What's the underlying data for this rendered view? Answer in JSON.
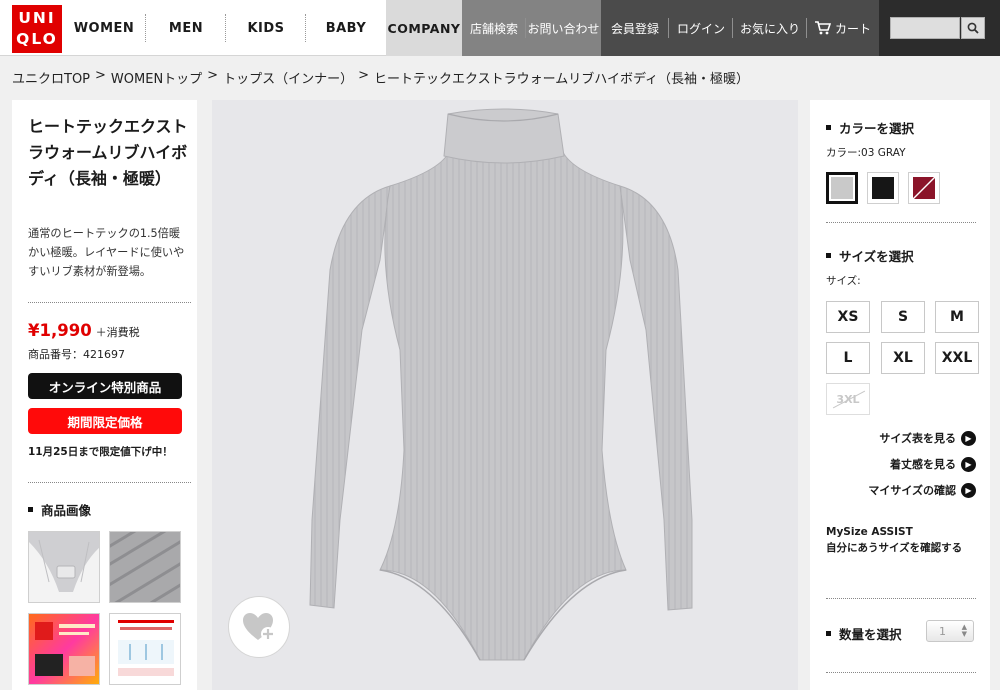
{
  "brand": {
    "logo_line1": "UNI",
    "logo_line2": "QLO",
    "brand_color": "#e00000"
  },
  "nav": {
    "items": [
      "WOMEN",
      "MEN",
      "KIDS",
      "BABY",
      "COMPANY"
    ],
    "utility": [
      "店舗検索",
      "お問い合わせ",
      "会員登録",
      "ログイン",
      "お気に入り",
      "カート"
    ],
    "search_placeholder": ""
  },
  "breadcrumb": [
    "ユニクロTOP",
    "WOMENトップ",
    "トップス（インナー）",
    "ヒートテックエクストラウォームリブハイボディ（長袖・極暖）"
  ],
  "breadcrumb_separator": ">",
  "product": {
    "title": "ヒートテックエクストラウォームリブハイボディ（長袖・極暖）",
    "description": "通常のヒートテックの1.5倍暖かい極暖。レイヤードに使いやすいリブ素材が新登場。",
    "price": "¥1,990",
    "tax_note": "＋消費税",
    "sku": "商品番号：421697",
    "badge_online": "オンライン特別商品",
    "badge_limited": "期間限定価格",
    "promo_note": "11月25日まで限定値下げ中！",
    "price_color": "#e00000"
  },
  "gallery": {
    "heading": "商品画像",
    "thumbs": [
      "bodysuit-closeup",
      "rib-fabric",
      "heattech-infographic",
      "heattech-diagram"
    ]
  },
  "main_image": {
    "alt_icon": "gray-ribbed-turtleneck-bodysuit",
    "favorite_icon": "heart-plus-icon"
  },
  "color": {
    "heading": "カラーを選択",
    "selected_label": "カラー:03 GRAY",
    "swatches": [
      {
        "name": "03 GRAY",
        "hex": "#c9c9c9",
        "selected": true
      },
      {
        "name": "BLACK",
        "hex": "#161616",
        "selected": false
      },
      {
        "name": "WINE",
        "hex": "#8b1429",
        "selected": false,
        "sold_out": true
      }
    ]
  },
  "size": {
    "heading": "サイズを選択",
    "label": "サイズ:",
    "options": [
      "XS",
      "S",
      "M",
      "L",
      "XL",
      "XXL",
      "3XL"
    ],
    "disabled": [
      "3XL"
    ],
    "links": [
      "サイズ表を見る",
      "着丈感を見る",
      "マイサイズの確認"
    ],
    "mysize_line1": "MySize ASSIST",
    "mysize_line2": "自分にあうサイズを確認する"
  },
  "quantity": {
    "heading": "数量を選択",
    "value": "1"
  }
}
